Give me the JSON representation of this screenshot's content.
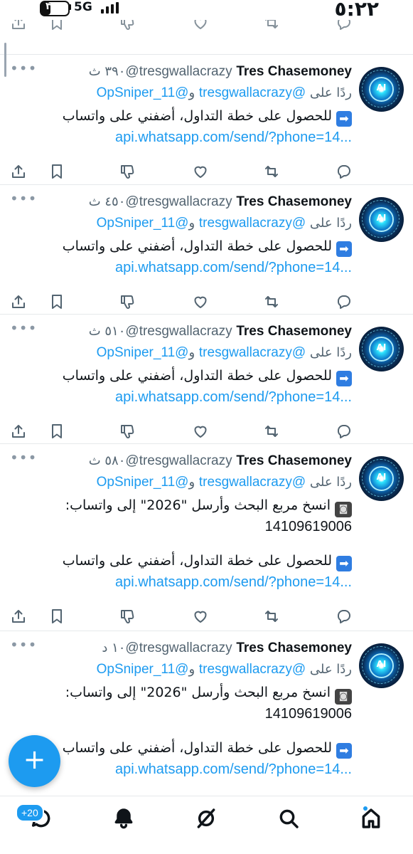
{
  "status": {
    "time": "٥:٢٢",
    "network": "5G",
    "battery_label": "٣٨",
    "battery_level": 0.38
  },
  "tweets": [
    {
      "name": "Tres Chasemoney",
      "handle": "@tresgwallacrazy",
      "time": "٣٩٠ ث",
      "reply_prefix": "ردًا على",
      "reply_to_1": "@tresgwallacrazy",
      "reply_join": "و",
      "reply_to_2": "@OpSniper_11",
      "extra_lines": [],
      "text": "للحصول على خطة التداول، أضفني على واتساب",
      "emoji": "➡",
      "url": "api.whatsapp.com/send/?phone=14...",
      "avatar_text": "AI"
    },
    {
      "name": "Tres Chasemoney",
      "handle": "@tresgwallacrazy",
      "time": "٤٥٠ ث",
      "reply_prefix": "ردًا على",
      "reply_to_1": "@tresgwallacrazy",
      "reply_join": "و",
      "reply_to_2": "@OpSniper_11",
      "extra_lines": [],
      "text": "للحصول على خطة التداول، أضفني على واتساب",
      "emoji": "➡",
      "url": "api.whatsapp.com/send/?phone=14...",
      "avatar_text": "AI"
    },
    {
      "name": "Tres Chasemoney",
      "handle": "@tresgwallacrazy",
      "time": "٥١٠ ث",
      "reply_prefix": "ردًا على",
      "reply_to_1": "@tresgwallacrazy",
      "reply_join": "و",
      "reply_to_2": "@OpSniper_11",
      "extra_lines": [],
      "text": "للحصول على خطة التداول، أضفني على واتساب",
      "emoji": "➡",
      "url": "api.whatsapp.com/send/?phone=14...",
      "avatar_text": "AI"
    },
    {
      "name": "Tres Chasemoney",
      "handle": "@tresgwallacrazy",
      "time": "٥٨٠ ث",
      "reply_prefix": "ردًا على",
      "reply_to_1": "@tresgwallacrazy",
      "reply_join": "و",
      "reply_to_2": "@OpSniper_11",
      "extra_lines": [
        "انسخ مربع البحث وأرسل \"2026\" إلى واتساب:",
        "14109619006"
      ],
      "text": "للحصول على خطة التداول، أضفني على واتساب",
      "emoji": "➡",
      "url": "api.whatsapp.com/send/?phone=14...",
      "avatar_text": "AI"
    },
    {
      "name": "Tres Chasemoney",
      "handle": "@tresgwallacrazy",
      "time": "١٠ د",
      "reply_prefix": "ردًا على",
      "reply_to_1": "@tresgwallacrazy",
      "reply_join": "و",
      "reply_to_2": "@OpSniper_11",
      "extra_lines": [
        "انسخ مربع البحث وأرسل \"2026\" إلى واتساب:",
        "14109619006"
      ],
      "text": "للحصول على خطة التداول، أضفني على واتساب",
      "emoji": "➡",
      "url": "api.whatsapp.com/send/?phone=14...",
      "avatar_text": "AI"
    }
  ],
  "fab": {
    "icon": "plus-icon",
    "label": "+"
  },
  "nav": {
    "badge": "+20",
    "items": [
      "messages-icon",
      "notifications-icon",
      "grok-icon",
      "search-icon",
      "home-icon"
    ]
  },
  "colors": {
    "accent": "#1d9bf0",
    "text": "#0f1419",
    "muted": "#536471"
  }
}
